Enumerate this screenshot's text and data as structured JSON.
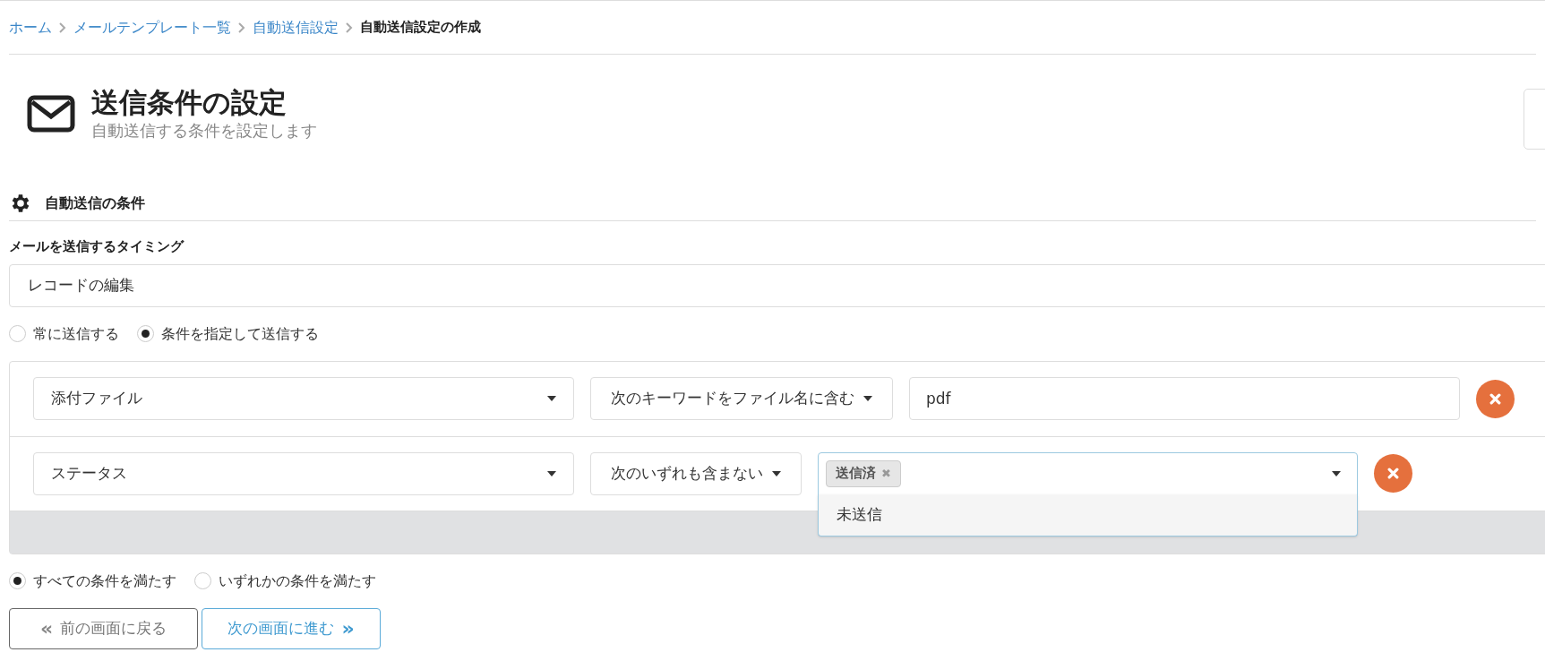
{
  "breadcrumb": [
    {
      "label": "ホーム",
      "current": false
    },
    {
      "label": "メールテンプレート一覧",
      "current": false
    },
    {
      "label": "自動送信設定",
      "current": false
    },
    {
      "label": "自動送信設定の作成",
      "current": true
    }
  ],
  "header": {
    "title": "送信条件の設定",
    "subtitle": "自動送信する条件を設定します"
  },
  "section": {
    "title": "自動送信の条件"
  },
  "timing": {
    "label": "メールを送信するタイミング",
    "value": "レコードの編集"
  },
  "send_mode": [
    {
      "label": "常に送信する",
      "selected": false
    },
    {
      "label": "条件を指定して送信する",
      "selected": true
    }
  ],
  "conditions": [
    {
      "field": "添付ファイル",
      "operator": "次のキーワードをファイル名に含む",
      "kind": "text",
      "value": "pdf"
    },
    {
      "field": "ステータス",
      "operator": "次のいずれも含まない",
      "kind": "multiselect",
      "tags": [
        "送信済"
      ],
      "remove_tag": "✖",
      "open": true,
      "options": [
        "未送信"
      ]
    }
  ],
  "match_mode": [
    {
      "label": "すべての条件を満たす",
      "selected": true
    },
    {
      "label": "いずれかの条件を満たす",
      "selected": false
    }
  ],
  "buttons": [
    {
      "label": "前の画面に戻る",
      "kind": "back",
      "icon": "«"
    },
    {
      "label": "次の画面に進む",
      "kind": "next",
      "icon": "»"
    }
  ]
}
